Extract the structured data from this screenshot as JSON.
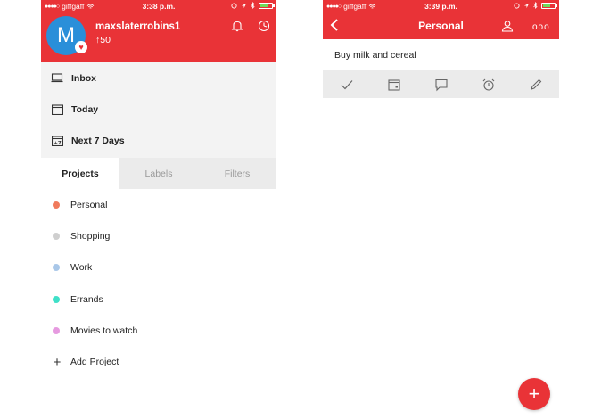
{
  "colors": {
    "brand_red": "#e93337",
    "avatar_blue": "#2a8fd9",
    "battery_green": "#6fdc5b"
  },
  "left": {
    "status": {
      "carrier": "giffgaff",
      "time": "3:38 p.m."
    },
    "profile": {
      "avatar_letter": "M",
      "username": "maxslaterrobins1",
      "karma": "↑50"
    },
    "nav": [
      {
        "label": "Inbox",
        "icon": "inbox-icon"
      },
      {
        "label": "Today",
        "icon": "calendar-icon"
      },
      {
        "label": "Next 7 Days",
        "icon": "calendar-7-icon",
        "icon_text": "+7"
      }
    ],
    "tabs": [
      {
        "label": "Projects",
        "active": true
      },
      {
        "label": "Labels",
        "active": false
      },
      {
        "label": "Filters",
        "active": false
      }
    ],
    "projects": [
      {
        "label": "Personal",
        "color": "#f07a5c"
      },
      {
        "label": "Shopping",
        "color": "#cfcfcf"
      },
      {
        "label": "Work",
        "color": "#a9c7e8"
      },
      {
        "label": "Errands",
        "color": "#3fe0c8"
      },
      {
        "label": "Movies to watch",
        "color": "#e69ae0"
      }
    ],
    "add_project": "Add Project"
  },
  "right": {
    "status": {
      "carrier": "giffgaff",
      "time": "3:39 p.m."
    },
    "title": "Personal",
    "task": "Buy milk and cereal",
    "more_label": "ooo",
    "fab_label": "+"
  }
}
